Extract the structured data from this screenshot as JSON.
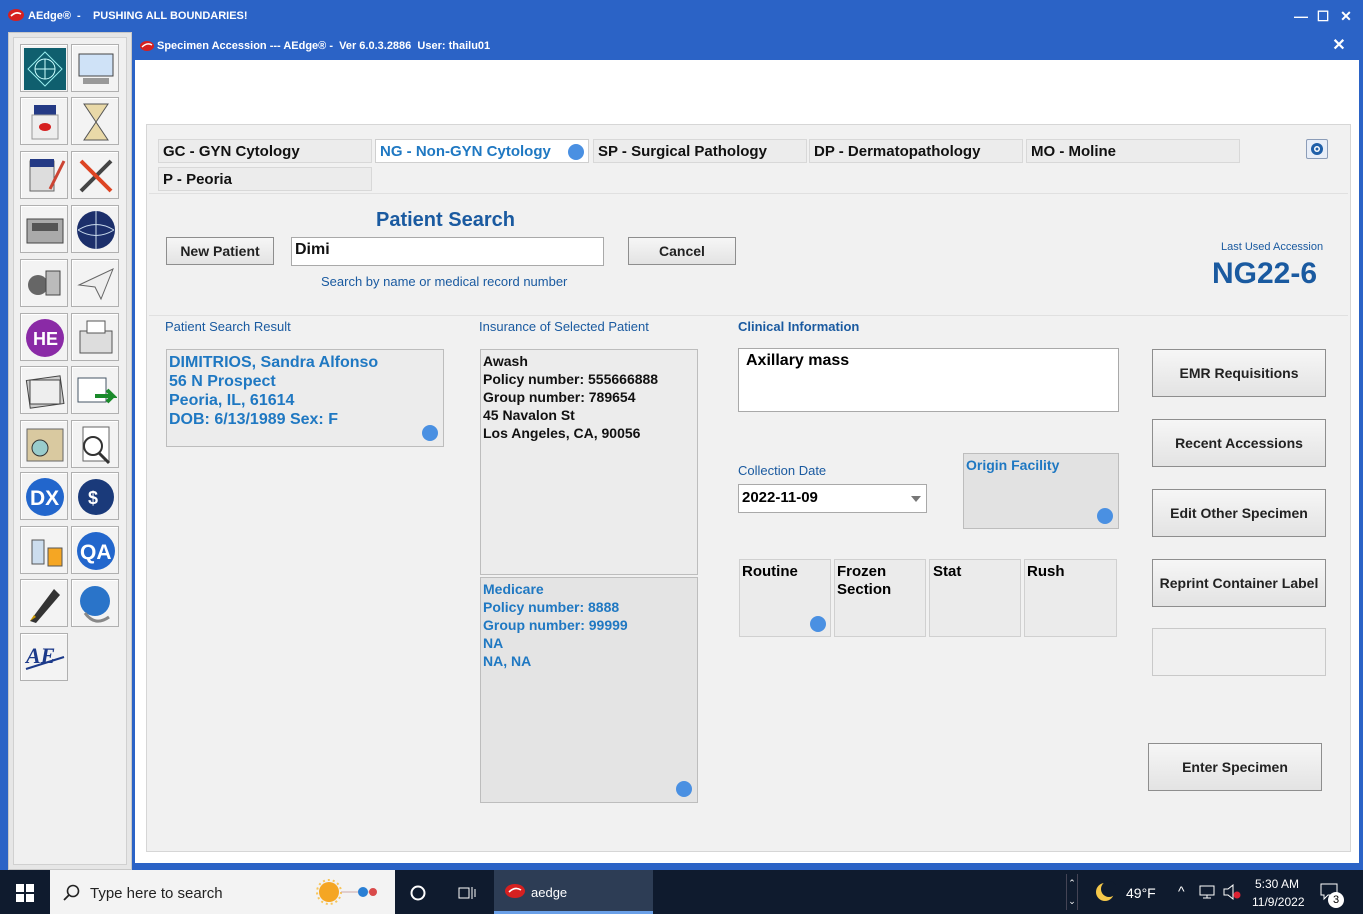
{
  "outer_window": {
    "title": "AEdge®  -    PUSHING ALL BOUNDARIES!"
  },
  "inner_window": {
    "title": "Specimen Accession --- AEdge® -  Ver 6.0.3.2886  User: thailu01"
  },
  "toolbar": {
    "icons": [
      "hospital-network-icon",
      "workstation-icon",
      "specimen-jar-icon",
      "hourglass-icon",
      "jar-edit-icon",
      "tools-icon",
      "printer-equipment-icon",
      "globe-icon",
      "microtome-icon",
      "paper-plane-icon",
      "he-stain-icon",
      "fax-icon",
      "reports-stack-icon",
      "email-export-icon",
      "slide-magnify-icon",
      "search-document-icon",
      "dx-icon",
      "billing-icon",
      "lab-beakers-icon",
      "qa-icon",
      "pen-icon",
      "web-service-icon",
      "aedge-logo-icon"
    ]
  },
  "tabs": [
    {
      "label": "GC - GYN Cytology",
      "active": false
    },
    {
      "label": "NG - Non-GYN Cytology",
      "active": true
    },
    {
      "label": "SP - Surgical Pathology",
      "active": false
    },
    {
      "label": "DP - Dermatopathology",
      "active": false
    },
    {
      "label": "MO - Moline",
      "active": false
    },
    {
      "label": "P - Peoria",
      "active": false
    }
  ],
  "search": {
    "title": "Patient Search",
    "new_patient_label": "New Patient",
    "query": "Dimi",
    "cancel_label": "Cancel",
    "hint": "Search by name or medical record number"
  },
  "last_accession": {
    "label": "Last Used Accession",
    "value": "NG22-6"
  },
  "patient_result": {
    "header": "Patient Search Result",
    "text": "DIMITRIOS, Sandra Alfonso\n56 N Prospect\nPeoria, IL, 61614\nDOB: 6/13/1989 Sex: F"
  },
  "insurance": {
    "header": "Insurance of Selected Patient",
    "primary": "Awash\nPolicy number: 555666888\nGroup number: 789654\n45 Navalon St\nLos Angeles, CA, 90056",
    "secondary": "Medicare\nPolicy number: 8888\nGroup number: 99999\nNA\nNA, NA"
  },
  "clinical": {
    "header": "Clinical Information",
    "text": "Axillary mass",
    "collection_date_label": "Collection Date",
    "collection_date": "2022-11-09",
    "origin_facility_label": "Origin Facility"
  },
  "priority": [
    {
      "label": "Routine",
      "selected": true
    },
    {
      "label": "Frozen\nSection",
      "selected": false
    },
    {
      "label": "Stat",
      "selected": false
    },
    {
      "label": "Rush",
      "selected": false
    }
  ],
  "side_buttons": {
    "emr": "EMR Requisitions",
    "recent": "Recent Accessions",
    "edit_other": "Edit Other Specimen",
    "reprint": "Reprint Container Label",
    "enter": "Enter Specimen"
  },
  "taskbar": {
    "search_placeholder": "Type here to search",
    "app_label": "aedge",
    "temperature": "49°F",
    "time": "5:30 AM",
    "date": "11/9/2022",
    "notification_count": "3"
  },
  "colors": {
    "title_bar": "#2b63c6",
    "accent_text": "#1f78c2",
    "dot": "#4a90e2",
    "heading": "#1a5aa0"
  }
}
